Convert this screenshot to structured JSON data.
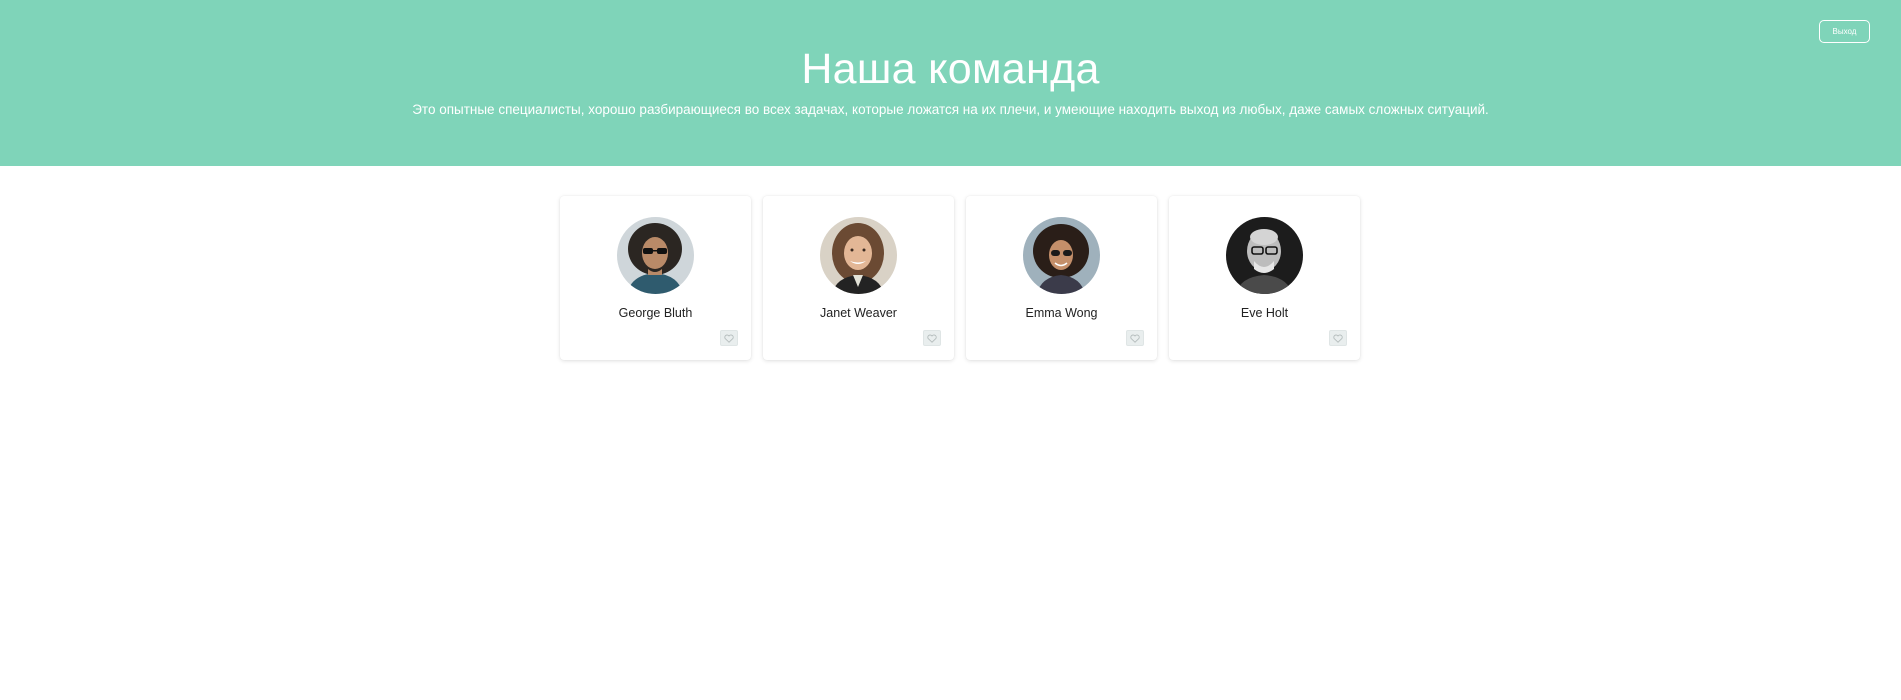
{
  "header": {
    "title": "Наша команда",
    "subtitle": "Это опытные специалисты, хорошо разбирающиеся во всех задачах, которые ложатся на их плечи, и умеющие находить выход из любых, даже самых сложных ситуаций.",
    "logout_label": "Выход"
  },
  "team": [
    {
      "name": "George Bluth",
      "like_icon": "heart-outline-icon"
    },
    {
      "name": "Janet Weaver",
      "like_icon": "heart-outline-icon"
    },
    {
      "name": "Emma Wong",
      "like_icon": "heart-outline-icon"
    },
    {
      "name": "Eve Holt",
      "like_icon": "heart-outline-icon"
    }
  ],
  "colors": {
    "header_bg": "#7fd4b9",
    "header_text": "#ffffff",
    "card_bg": "#ffffff",
    "like_bg": "#e9eeee"
  }
}
